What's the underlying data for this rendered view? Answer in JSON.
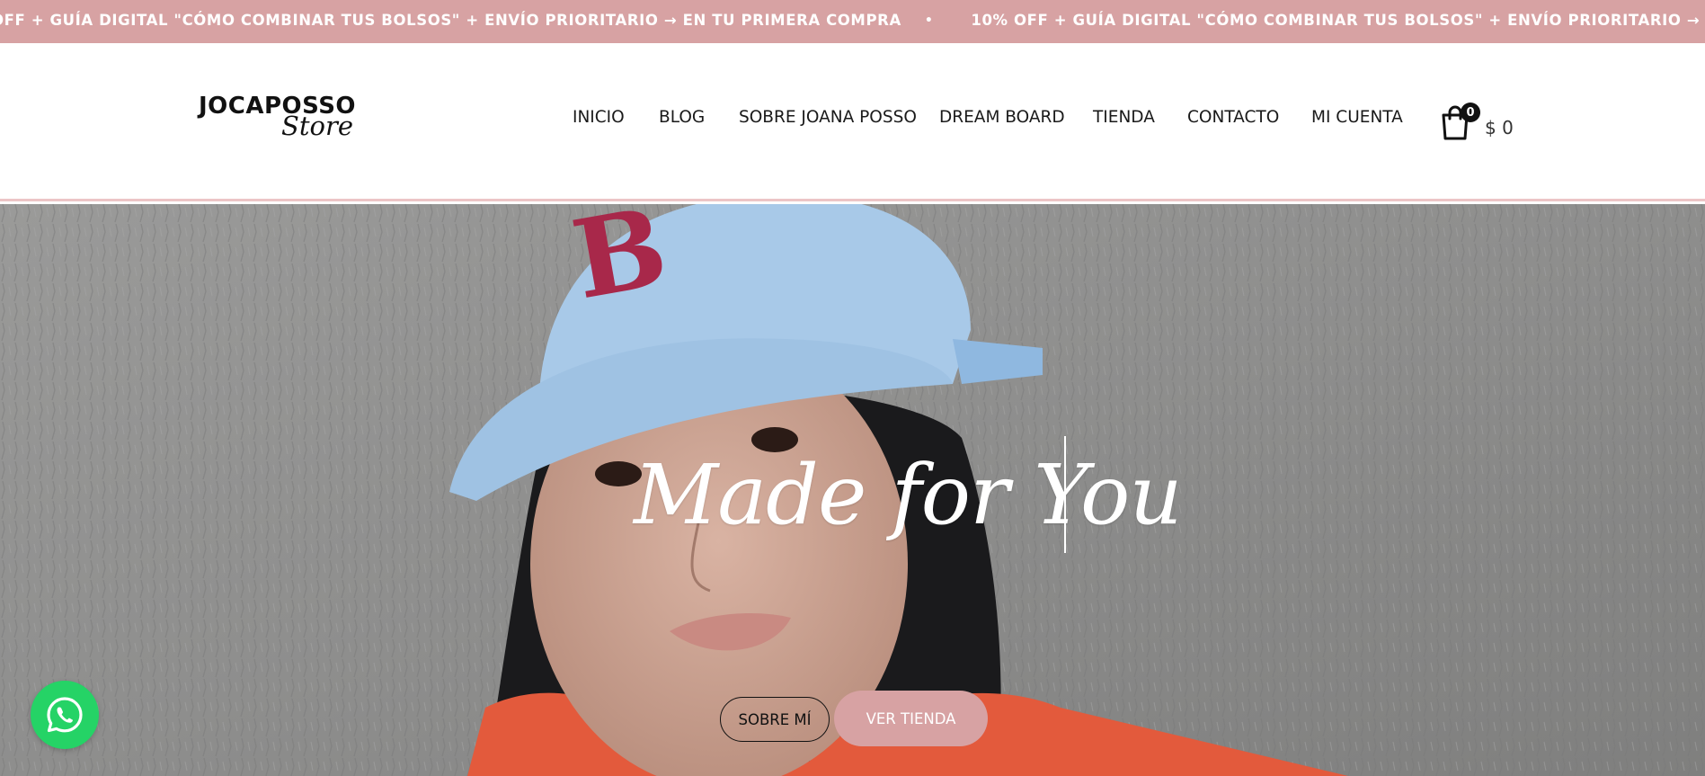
{
  "announcement": {
    "messages": [
      "10% OFF + GUÍA DIGITAL \"CÓMO COMBINAR TUS BOLSOS\" + ENVÍO PRIORITARIO → EN TU PRIMERA COMPRA",
      "10% OFF + GUÍA DIGITAL \"CÓMO COMBINAR TUS BOLSOS\" + ENVÍO PRIORITARIO → EN TU PRIMERA COMPRA"
    ],
    "separator": "•",
    "visible_fragments": [
      "OFF + GUÍA DIGITAL \"CÓMO COMBINAR TUS BOLSOS\" + ENVÍO PRIORITARIO → EN TU PRIMERA COMPRA",
      "10% OFF + GUÍA DIGITAL \"CÓMO COMBINAR TUS BOLSOS\" + ENVÍO PRIORITARIO → EN TU"
    ],
    "background_color": "#d7a2a3"
  },
  "logo": {
    "main_text": "JOCAPOSSO",
    "script_text": "Store"
  },
  "nav": {
    "items": [
      {
        "label": "INICIO"
      },
      {
        "label": "BLOG"
      },
      {
        "label": "SOBRE JOANA POSSO"
      },
      {
        "label": "DREAM BOARD"
      },
      {
        "label": "TIENDA"
      },
      {
        "label": "CONTACTO"
      },
      {
        "label": "MI CUENTA"
      }
    ]
  },
  "cart": {
    "count": "0",
    "total": "$ 0",
    "icon": "shopping-bag-icon"
  },
  "hero": {
    "title": "Made for You",
    "buttons": {
      "about": "SOBRE MÍ",
      "shop": "VER TIENDA"
    },
    "accent_color": "#d7a2a3"
  },
  "whatsapp": {
    "icon": "whatsapp-icon",
    "color": "#25d366"
  }
}
